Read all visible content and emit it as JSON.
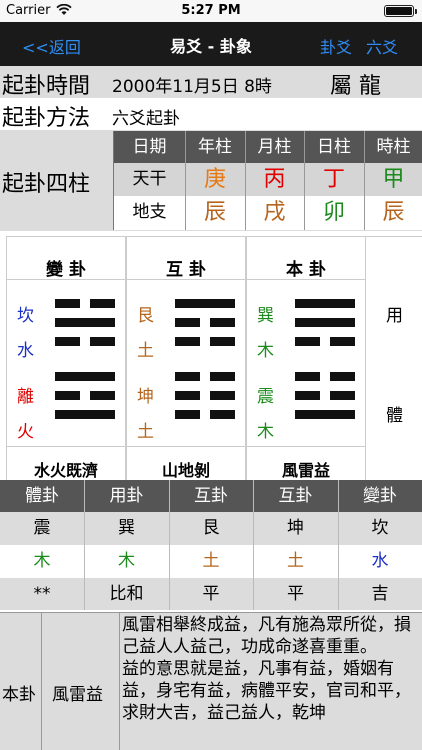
{
  "status": {
    "carrier": "Carrier",
    "time": "5:27 PM"
  },
  "nav": {
    "back": "<<返回",
    "title": "易爻 - 卦象",
    "right1": "卦爻",
    "right2": "六爻"
  },
  "info": {
    "time_label": "起卦時間",
    "datetime": "2000年11月5日 8時",
    "zodiac": "屬 龍",
    "method_label": "起卦方法",
    "method": "六爻起卦",
    "pillars_label": "起卦四柱"
  },
  "pillars": {
    "headers": [
      "日期",
      "年柱",
      "月柱",
      "日柱",
      "時柱"
    ],
    "row_stem": {
      "label": "天干",
      "values": [
        "庚",
        "丙",
        "丁",
        "甲"
      ]
    },
    "row_branch": {
      "label": "地支",
      "values": [
        "辰",
        "戌",
        "卯",
        "辰"
      ]
    }
  },
  "colors": {
    "metal": "#e67a16",
    "fire": "#e00000",
    "wood": "#1c8a1c",
    "earth": "#b5651d",
    "water": "#1b30c8",
    "header_bg": "#555555",
    "link": "#2f8df5"
  },
  "hexagrams": [
    {
      "title": "變 卦",
      "name": "水火既濟",
      "upper": {
        "gua": "坎",
        "element": "水"
      },
      "lower": {
        "gua": "離",
        "element": "火"
      },
      "lines_top_down": [
        0,
        1,
        0,
        1,
        0,
        1
      ]
    },
    {
      "title": "互 卦",
      "name": "山地剝",
      "upper": {
        "gua": "艮",
        "element": "土"
      },
      "lower": {
        "gua": "坤",
        "element": "土"
      },
      "lines_top_down": [
        1,
        0,
        0,
        0,
        0,
        0
      ]
    },
    {
      "title": "本 卦",
      "name": "風雷益",
      "upper": {
        "gua": "巽",
        "element": "木"
      },
      "lower": {
        "gua": "震",
        "element": "木"
      },
      "lines_top_down": [
        1,
        1,
        0,
        0,
        0,
        1
      ]
    }
  ],
  "yongti": {
    "upper": "用",
    "lower": "體"
  },
  "relations": {
    "headers": [
      "體卦",
      "用卦",
      "互卦",
      "互卦",
      "變卦"
    ],
    "gua": [
      "震",
      "巽",
      "艮",
      "坤",
      "坎"
    ],
    "elements": [
      "木",
      "木",
      "土",
      "土",
      "水"
    ],
    "judgement": [
      "**",
      "比和",
      "平",
      "平",
      "吉"
    ]
  },
  "explain": {
    "label": "本卦",
    "name": "風雷益",
    "text1": "風雷相舉終成益，凡有施為眾所從，損己益人人益己，功成命遂喜重重。",
    "text2": "益的意思就是益，凡事有益，婚姻有益，身宅有益，病體平安，官司和平，求財大吉，益己益人，乾坤"
  }
}
